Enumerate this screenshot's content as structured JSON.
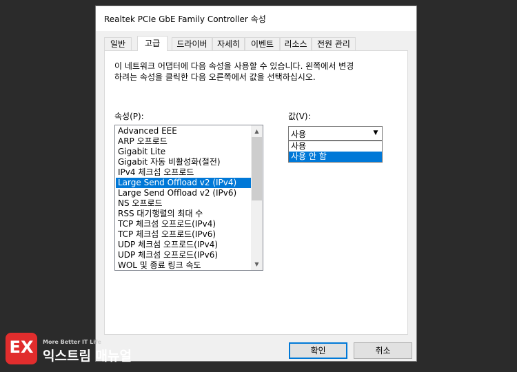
{
  "window": {
    "title": "Realtek PCIe GbE Family Controller 속성"
  },
  "tabs": [
    {
      "label": "일반"
    },
    {
      "label": "고급"
    },
    {
      "label": "드라이버"
    },
    {
      "label": "자세히"
    },
    {
      "label": "이벤트"
    },
    {
      "label": "리소스"
    },
    {
      "label": "전원 관리"
    }
  ],
  "active_tab": "고급",
  "panel": {
    "description_line1": "이 네트워크 어댑터에 다음 속성을 사용할 수 있습니다. 왼쪽에서 변경",
    "description_line2": "하려는 속성을 클릭한 다음 오른쪽에서 값을 선택하십시오.",
    "property_label": "속성(P):",
    "value_label": "값(V):"
  },
  "properties": [
    {
      "label": "Advanced EEE"
    },
    {
      "label": "ARP 오프로드"
    },
    {
      "label": "Gigabit Lite"
    },
    {
      "label": "Gigabit 자동 비활성화(절전)"
    },
    {
      "label": "IPv4 체크섬 오프로드"
    },
    {
      "label": "Large Send Offload v2 (IPv4)"
    },
    {
      "label": "Large Send Offload v2 (IPv6)"
    },
    {
      "label": "NS 오프로드"
    },
    {
      "label": "RSS 대기행렬의 최대 수"
    },
    {
      "label": "TCP 체크섬 오프로드(IPv4)"
    },
    {
      "label": "TCP 체크섬 오프로드(IPv6)"
    },
    {
      "label": "UDP 체크섬 오프로드(IPv4)"
    },
    {
      "label": "UDP 체크섬 오프로드(IPv6)"
    },
    {
      "label": "WOL 및 종료 링크 속도"
    }
  ],
  "selected_property": "Large Send Offload v2 (IPv4)",
  "value_combo": {
    "current": "사용",
    "options": [
      {
        "label": "사용"
      },
      {
        "label": "사용 안 함"
      }
    ],
    "highlighted": "사용 안 함"
  },
  "buttons": {
    "ok": "확인",
    "cancel": "취소"
  },
  "watermark": {
    "logo_letters": "EX",
    "tagline": "More Better IT Life",
    "name": "익스트림 매뉴얼",
    "brand_color": "#e12d2d"
  },
  "colors": {
    "selection": "#0078d7",
    "dialog_bg": "#f0f0f0"
  }
}
